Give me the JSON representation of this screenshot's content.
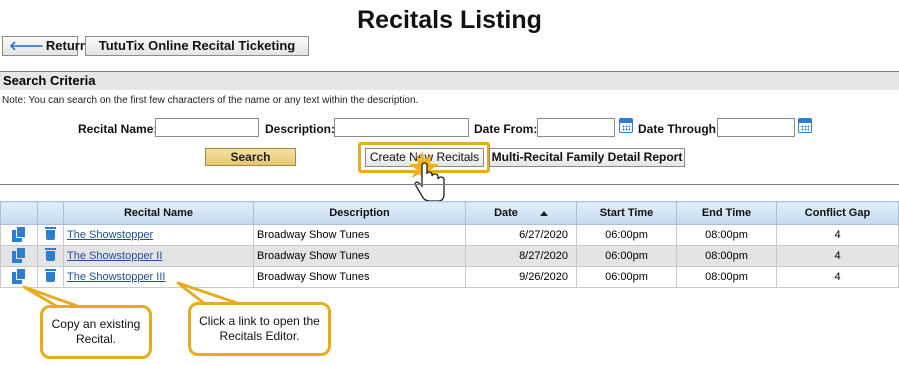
{
  "page": {
    "title": "Recitals Listing"
  },
  "toolbar": {
    "return_label": "Return",
    "return_icon": "left-arrow-icon",
    "tutu_label": "TutuTix Online Recital Ticketing"
  },
  "criteria": {
    "heading": "Search Criteria",
    "note": "Note: You can search on the first few characters of the name or any text within the description.",
    "recital_name_label": "Recital Name:",
    "description_label": "Description:",
    "date_from_label": "Date From:",
    "date_through_label": "Date Through:",
    "search_button": "Search",
    "create_button": "Create New Recitals",
    "multi_report_button": "Multi-Recital Family Detail Report"
  },
  "table": {
    "headers": [
      "Recital Name",
      "Description",
      "Date",
      "Start Time",
      "End Time",
      "Conflict Gap"
    ],
    "sorted_by": "Date",
    "sort_direction": "ascending",
    "rows": [
      {
        "name": "The Showstopper",
        "description": "Broadway Show Tunes",
        "date": "6/27/2020",
        "start": "06:00pm",
        "end": "08:00pm",
        "gap": "4"
      },
      {
        "name": "The Showstopper II",
        "description": "Broadway Show Tunes",
        "date": "8/27/2020",
        "start": "06:00pm",
        "end": "08:00pm",
        "gap": "4"
      },
      {
        "name": "The Showstopper III",
        "description": "Broadway Show Tunes",
        "date": "9/26/2020",
        "start": "06:00pm",
        "end": "08:00pm",
        "gap": "4"
      }
    ]
  },
  "callouts": {
    "copy": "Copy an existing Recital.",
    "link": "Click a link to open the Recitals Editor."
  },
  "colors": {
    "accent": "#e7ac1e",
    "icon_blue": "#2c7fd0",
    "header_bg": "#c5daf0",
    "search_btn": "#e6c670"
  }
}
